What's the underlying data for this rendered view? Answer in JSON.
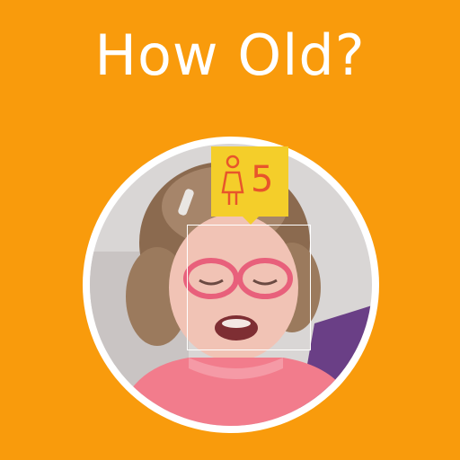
{
  "title": "How Old?",
  "age_result": {
    "age": "5",
    "gender": "female-icon"
  },
  "colors": {
    "background": "#F99B0C",
    "frame": "#FFFFFF",
    "badge": "#F4CE2A",
    "badge_text": "#E8552B"
  }
}
